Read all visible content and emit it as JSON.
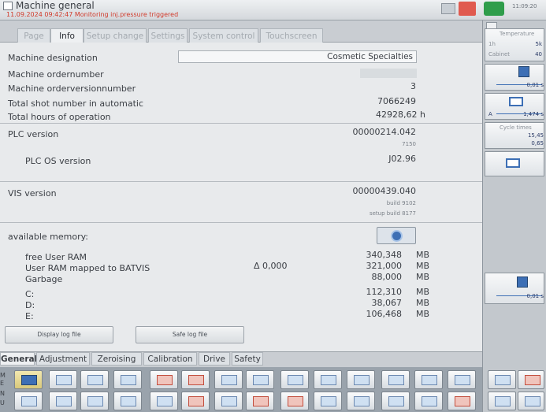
{
  "titlebar": {
    "title": "Machine general",
    "alarm": "11.09.2024 09:42:47  Monitoring inj.pressure triggered",
    "clock": "11:09:20"
  },
  "top_tabs": [
    "Page",
    "Info",
    "Setup change",
    "Settings",
    "System control",
    "Touchscreen"
  ],
  "info": {
    "machine_designation_label": "Machine designation",
    "machine_designation_value": "Cosmetic Specialties",
    "machine_ordernumber_label": "Machine ordernumber",
    "machine_orderversionnumber_label": "Machine orderversionnumber",
    "machine_orderversionnumber_value": "3",
    "total_shot_label": "Total shot number in automatic",
    "total_shot_value": "7066249",
    "total_hours_label": "Total hours of operation",
    "total_hours_value": "42928,62 h",
    "plc_version_label": "PLC version",
    "plc_version_value": "00000214.042",
    "plc_build": "7150",
    "plc_os_label": "PLC OS version",
    "plc_os_value": "J02.96",
    "vis_version_label": "VIS version",
    "vis_version_value": "00000439.040",
    "vis_build": "build 9102",
    "vis_setup_build": "setup build 8177"
  },
  "memory": {
    "title": "available memory:",
    "delta": "Δ 0,000",
    "rows": [
      {
        "label": "free User RAM",
        "value": "340,348",
        "unit": "MB"
      },
      {
        "label": "User RAM mapped to BATVIS",
        "value": "321,000",
        "unit": "MB"
      },
      {
        "label": "Garbage",
        "value": "88,000",
        "unit": "MB"
      },
      {
        "label": "C:",
        "value": "112,310",
        "unit": "MB"
      },
      {
        "label": "D:",
        "value": "38,067",
        "unit": "MB"
      },
      {
        "label": "E:",
        "value": "106,468",
        "unit": "MB"
      }
    ]
  },
  "buttons": {
    "display_log": "Display log file",
    "save_log": "Safe log file"
  },
  "bottom_tabs": [
    "General",
    "Adjustment",
    "Zeroising",
    "Calibration",
    "Drive",
    "Safety"
  ],
  "toolbar_letters": [
    "M",
    "E",
    "N",
    "U"
  ],
  "right_panel": {
    "temperature_label": "Temperature",
    "temperature_row1_left": "1h",
    "temperature_row1_right": "5k",
    "temperature_row2_left": "Cabinet",
    "temperature_row2_right": "40",
    "value1": "0,01 s",
    "value2": "1,474 s",
    "value2_prefix": "A",
    "cycle_label": "Cycle times",
    "cycle_val1": "15,45",
    "cycle_val2": "0,65",
    "value3": "0,01 s"
  },
  "colors": {
    "accent_blue": "#3d6fb5",
    "alarm_red": "#d23a2a",
    "go_green": "#2f9d4b",
    "panel": "#e8eaec"
  }
}
